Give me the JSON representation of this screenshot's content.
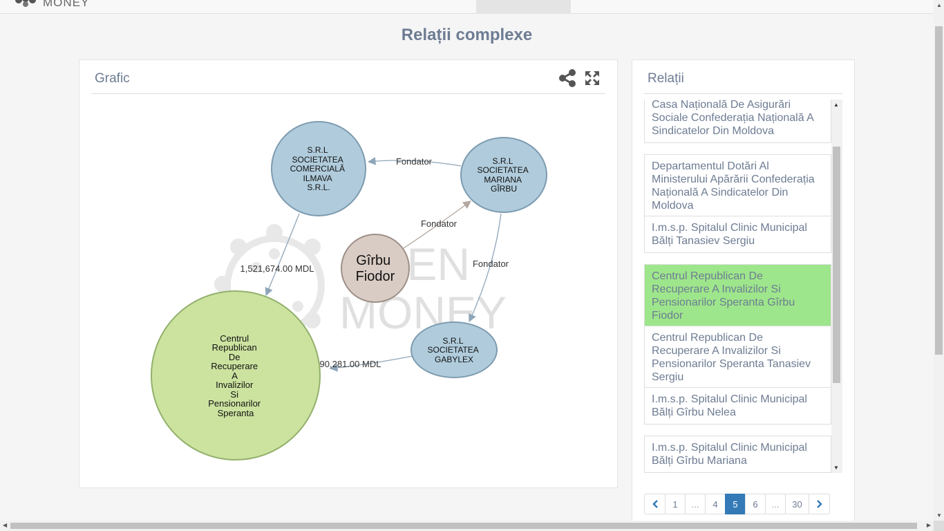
{
  "brand": {
    "logo_text": "MONEY",
    "logo_icon": "molecule-logo-icon"
  },
  "page_title": "Relații complexe",
  "graph_panel": {
    "title": "Grafic",
    "share_icon": "share-icon",
    "expand_icon": "expand-icon",
    "watermark": {
      "line1": "OPEN",
      "line2": "MONEY"
    },
    "nodes": {
      "ilmava": [
        "S.R.L",
        "SOCIETATEA",
        "COMERCIALĂ",
        "ILMAVA",
        "S.R.L."
      ],
      "mariana": [
        "S.R.L",
        "SOCIETATEA",
        "MARIANA",
        "GÎRBU"
      ],
      "person": [
        "Gîrbu",
        "Fiodor"
      ],
      "gabylex": [
        "S.R.L",
        "SOCIETATEA",
        "GABYLEX"
      ],
      "centru": [
        "Centrul",
        "Republican",
        "De",
        "Recuperare",
        "A",
        "Invalizilor",
        "Si",
        "Pensionarilor",
        "Speranta"
      ]
    },
    "edge_labels": {
      "mariana_ilmava": "Fondator",
      "person_mariana": "Fondator",
      "mariana_gabylex": "Fondator",
      "ilmava_centru": "1,521,674.00 MDL",
      "gabylex_centru": "90,281.00 MDL"
    },
    "colors": {
      "company": "#b0ccdc",
      "person": "#d9ccc4",
      "target": "#cce3a0"
    }
  },
  "relations_panel": {
    "title": "Relații",
    "items": [
      {
        "label": "Casa Națională De Asigurări Sociale Confederația Națională A Sindicatelor Din Moldova",
        "active": false
      },
      {
        "label": "Departamentul Dotări Al Ministerului Apărării Confederația Națională A Sindicatelor Din Moldova",
        "active": false
      },
      {
        "label": "I.m.s.p. Spitalul Clinic Municipal Bălți Tanasiev Sergiu",
        "active": false
      },
      {
        "label": "Centrul Republican De Recuperare A Invalizilor Si Pensionarilor Speranta Gîrbu Fiodor",
        "active": true
      },
      {
        "label": "Centrul Republican De Recuperare A Invalizilor Si Pensionarilor Speranta Tanasiev Sergiu",
        "active": false
      },
      {
        "label": "I.m.s.p. Spitalul Clinic Municipal Bălți Gîrbu Nelea",
        "active": false
      },
      {
        "label": "I.m.s.p. Spitalul Clinic Municipal Bălți Gîrbu Mariana",
        "active": false
      }
    ],
    "pagination": {
      "prev_icon": "chevron-left-icon",
      "next_icon": "chevron-right-icon",
      "pages": [
        "1",
        "...",
        "4",
        "5",
        "6",
        "...",
        "30"
      ],
      "current": "5"
    }
  }
}
